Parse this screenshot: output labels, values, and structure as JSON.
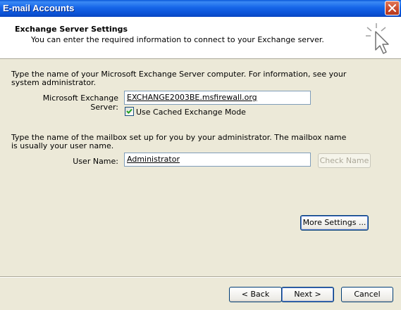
{
  "window": {
    "title": "E-mail Accounts"
  },
  "header": {
    "title": "Exchange Server Settings",
    "subtitle": "You can enter the required information to connect to your Exchange server."
  },
  "server_section": {
    "instructions_line1": "Type the name of your Microsoft Exchange Server computer. For information, see your",
    "instructions_line2": "system administrator.",
    "server_label": "Microsoft Exchange Server:",
    "server_value": "EXCHANGE2003BE.msfirewall.org",
    "cached_mode_label": "Use Cached Exchange Mode",
    "cached_mode_checked": true
  },
  "mailbox_section": {
    "instructions_line1": "Type the name of the mailbox set up for you by your administrator. The mailbox name",
    "instructions_line2": "is usually your user name.",
    "user_label": "User Name:",
    "user_value": "Administrator",
    "check_name_label": "Check Name"
  },
  "more_settings_label": "More Settings ...",
  "footer": {
    "back_label": "< Back",
    "next_label": "Next >",
    "cancel_label": "Cancel"
  },
  "icons": {
    "close": "close-icon",
    "wizard": "cursor-sparkle-icon",
    "check": "checkmark-icon"
  }
}
